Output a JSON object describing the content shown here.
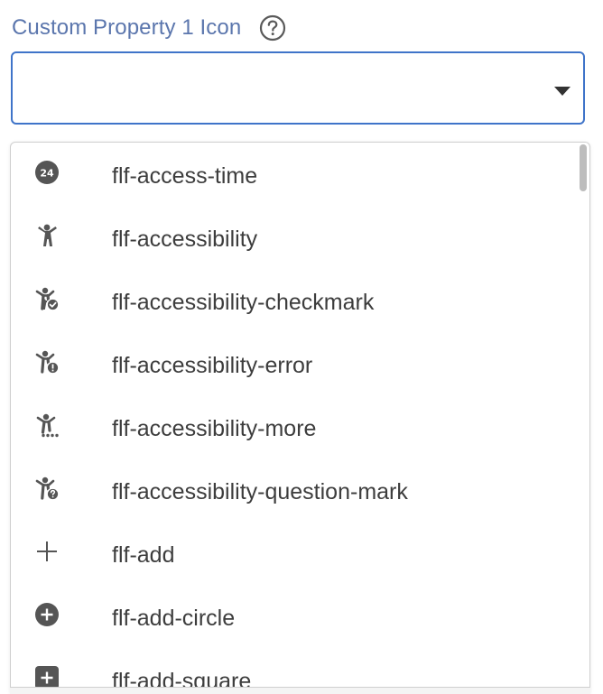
{
  "field": {
    "label": "Custom Property 1 Icon",
    "help_icon": "question-circle-icon",
    "selected_value": "",
    "caret_icon": "caret-down-icon"
  },
  "options": [
    {
      "label": "flf-access-time",
      "icon": "access-time-24-icon"
    },
    {
      "label": "flf-accessibility",
      "icon": "accessibility-icon"
    },
    {
      "label": "flf-accessibility-checkmark",
      "icon": "accessibility-checkmark-icon"
    },
    {
      "label": "flf-accessibility-error",
      "icon": "accessibility-error-icon"
    },
    {
      "label": "flf-accessibility-more",
      "icon": "accessibility-more-icon"
    },
    {
      "label": "flf-accessibility-question-mark",
      "icon": "accessibility-question-mark-icon"
    },
    {
      "label": "flf-add",
      "icon": "plus-icon"
    },
    {
      "label": "flf-add-circle",
      "icon": "add-circle-icon"
    },
    {
      "label": "flf-add-square",
      "icon": "add-square-icon"
    }
  ],
  "colors": {
    "label": "#5b76ad",
    "focus_border": "#3f74c9",
    "icon": "#555555",
    "text": "#3d3d3d"
  }
}
